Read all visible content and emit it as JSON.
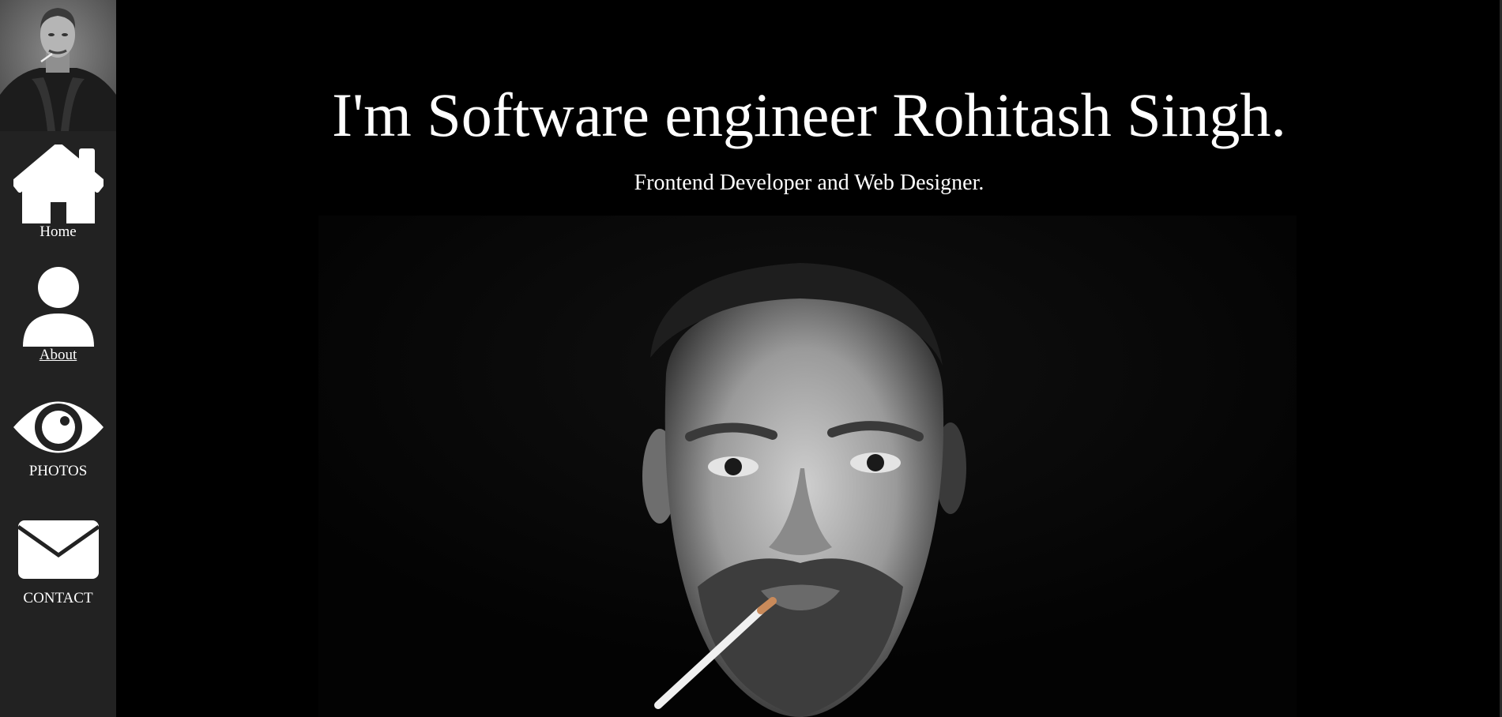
{
  "sidebar": {
    "nav": [
      {
        "label": "Home",
        "icon": "home-icon"
      },
      {
        "label": "About",
        "icon": "user-icon"
      },
      {
        "label": "PHOTOS",
        "icon": "eye-icon"
      },
      {
        "label": "CONTACT",
        "icon": "envelope-icon"
      }
    ]
  },
  "main": {
    "headline": "I'm Software engineer Rohitash Singh.",
    "subheadline": "Frontend Developer and Web Designer."
  },
  "colors": {
    "background": "#000000",
    "sidebar": "#222222",
    "text": "#ffffff"
  }
}
